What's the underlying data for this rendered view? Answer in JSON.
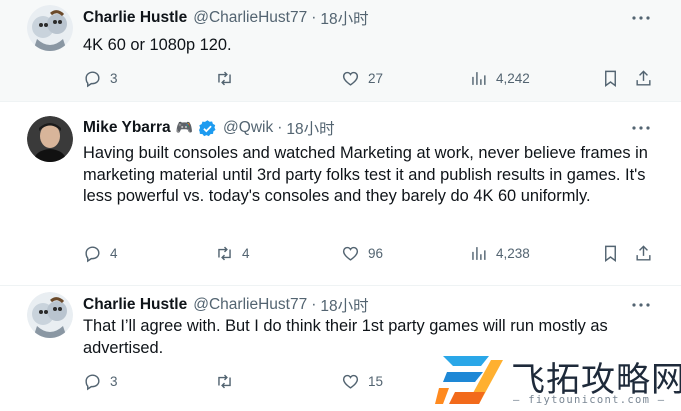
{
  "tweets": [
    {
      "name": "Charlie Hustle",
      "handle": "@CharlieHust77",
      "separator": "·",
      "time": "18小时",
      "text": "4K 60 or 1080p 120.",
      "replies": "3",
      "retweets": "",
      "likes": "27",
      "views": "4,242",
      "avatar_icon": "cartoon-avatar"
    },
    {
      "name": "Mike Ybarra",
      "emoji": "🎮",
      "verified_icon": "verified-badge-icon",
      "handle": "@Qwik",
      "separator": "·",
      "time": "18小时",
      "text": "Having built consoles and watched Marketing at work, never believe frames in marketing material until 3rd party folks test it and publish results in games. It's less powerful vs. today's consoles and they barely do 4K 60 uniformly.",
      "replies": "4",
      "retweets": "4",
      "likes": "96",
      "views": "4,238",
      "avatar_icon": "photo-avatar"
    },
    {
      "name": "Charlie Hustle",
      "handle": "@CharlieHust77",
      "separator": "·",
      "time": "18小时",
      "text": "That I’ll agree with. But I do think their 1st party games will run mostly as advertised.",
      "replies": "3",
      "retweets": "",
      "likes": "15",
      "views": "",
      "avatar_icon": "cartoon-avatar"
    }
  ],
  "watermark": {
    "text": "飞拓攻略网",
    "url": "— fiytounicont.com —"
  },
  "colors": {
    "text": "#0f1419",
    "secondary": "#536471",
    "verified": "#1d9bf0",
    "highlight_bg": "#f7f9f9"
  }
}
